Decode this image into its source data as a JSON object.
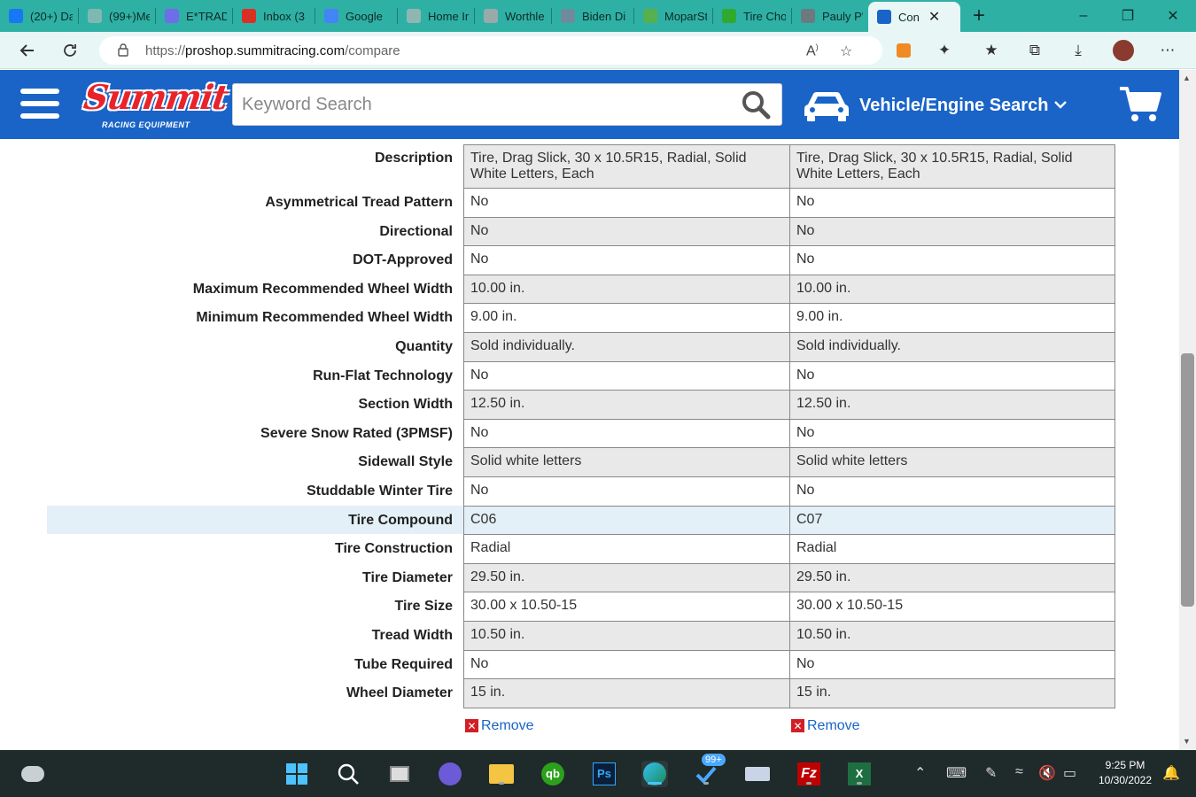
{
  "browser": {
    "tabs": [
      {
        "title": "(20+) Da",
        "icon": "facebook-icon",
        "color": "#1877f2"
      },
      {
        "title": "(99+)Me",
        "icon": "messages-icon",
        "color": "#7fb8b1"
      },
      {
        "title": "E*TRADE",
        "icon": "etrade-icon",
        "color": "#6d6ee8"
      },
      {
        "title": "Inbox (3",
        "icon": "gmail-icon",
        "color": "#d93025"
      },
      {
        "title": "Google",
        "icon": "google-calendar-icon",
        "color": "#4285f4"
      },
      {
        "title": "Home In",
        "icon": "home-icon",
        "color": "#8fb7b2"
      },
      {
        "title": "Worthle",
        "icon": "page-icon",
        "color": "#9aa"
      },
      {
        "title": "Biden Di",
        "icon": "news-icon",
        "color": "#6f8b9b"
      },
      {
        "title": "MoparSt",
        "icon": "moparstuff-icon",
        "color": "#56b04f"
      },
      {
        "title": "Tire Cho",
        "icon": "tire-icon",
        "color": "#2faa2f"
      },
      {
        "title": "Pauly P's",
        "icon": "avatar-icon",
        "color": "#6c7a80"
      },
      {
        "title": "Con",
        "icon": "summit-icon",
        "color": "#1a64c8",
        "active": true
      }
    ],
    "new_tab": "+",
    "url": {
      "scheme": "https://",
      "host": "proshop.summitracing.com",
      "path": "/compare"
    }
  },
  "site": {
    "search_placeholder": "Keyword Search",
    "vehicle_search_label": "Vehicle/Engine Search",
    "logo_text": "Summit",
    "logo_subtext": "RACING EQUIPMENT"
  },
  "compare": {
    "rows": [
      {
        "label": "Description",
        "values": [
          "Tire, Drag Slick, 30 x 10.5R15, Radial, Solid White Letters, Each",
          "Tire, Drag Slick, 30 x 10.5R15, Radial, Solid White Letters, Each"
        ]
      },
      {
        "label": "Asymmetrical Tread Pattern",
        "values": [
          "No",
          "No"
        ]
      },
      {
        "label": "Directional",
        "values": [
          "No",
          "No"
        ]
      },
      {
        "label": "DOT-Approved",
        "values": [
          "No",
          "No"
        ]
      },
      {
        "label": "Maximum Recommended Wheel Width",
        "values": [
          "10.00 in.",
          "10.00 in."
        ]
      },
      {
        "label": "Minimum Recommended Wheel Width",
        "values": [
          "9.00 in.",
          "9.00 in."
        ]
      },
      {
        "label": "Quantity",
        "values": [
          "Sold individually.",
          "Sold individually."
        ]
      },
      {
        "label": "Run-Flat Technology",
        "values": [
          "No",
          "No"
        ]
      },
      {
        "label": "Section Width",
        "values": [
          "12.50 in.",
          "12.50 in."
        ]
      },
      {
        "label": "Severe Snow Rated (3PMSF)",
        "values": [
          "No",
          "No"
        ]
      },
      {
        "label": "Sidewall Style",
        "values": [
          "Solid white letters",
          "Solid white letters"
        ]
      },
      {
        "label": "Studdable Winter Tire",
        "values": [
          "No",
          "No"
        ]
      },
      {
        "label": "Tire Compound",
        "values": [
          "C06",
          "C07"
        ],
        "highlight": true
      },
      {
        "label": "Tire Construction",
        "values": [
          "Radial",
          "Radial"
        ]
      },
      {
        "label": "Tire Diameter",
        "values": [
          "29.50 in.",
          "29.50 in."
        ]
      },
      {
        "label": "Tire Size",
        "values": [
          "30.00 x 10.50-15",
          "30.00 x 10.50-15"
        ]
      },
      {
        "label": "Tread Width",
        "values": [
          "10.50 in.",
          "10.50 in."
        ]
      },
      {
        "label": "Tube Required",
        "values": [
          "No",
          "No"
        ]
      },
      {
        "label": "Wheel Diameter",
        "values": [
          "15 in.",
          "15 in."
        ]
      }
    ],
    "remove_label": "Remove"
  },
  "taskbar": {
    "time": "9:25 PM",
    "date": "10/30/2022",
    "badge": "99+"
  }
}
